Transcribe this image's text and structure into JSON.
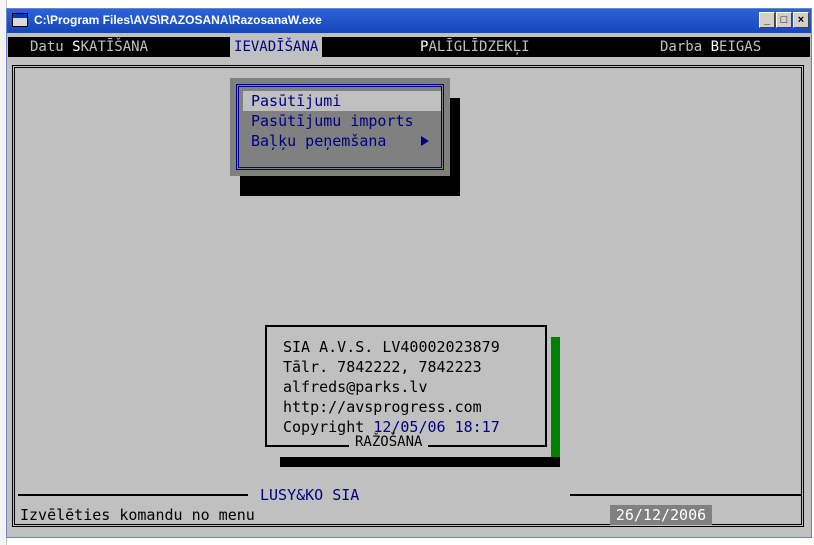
{
  "window": {
    "title": "C:\\Program Files\\AVS\\RAZOSANA\\RazosanaW.exe",
    "controls": {
      "minimize": "_",
      "maximize": "□",
      "close": "×"
    }
  },
  "menubar": {
    "items": [
      {
        "pre": "Datu ",
        "hot": "S",
        "post": "KATĪŠANA",
        "selected": false
      },
      {
        "pre": "",
        "hot": "I",
        "post": "EVADĪŠANA",
        "selected": true
      },
      {
        "pre": "",
        "hot": "P",
        "post": "ALĪGLĪDZEKĻI",
        "selected": false
      },
      {
        "pre": "Darba ",
        "hot": "B",
        "post": "EIGAS",
        "selected": false
      }
    ]
  },
  "dropdown": {
    "items": [
      {
        "label": "Pasūtījumi",
        "active": true
      },
      {
        "label": "Pasūtījumu imports",
        "active": false
      },
      {
        "label": "Baļķu peņemšana",
        "active": false
      }
    ]
  },
  "info": {
    "line1": "SIA A.V.S. LV40002023879",
    "line2": "Tālr. 7842222, 7842223",
    "line3": "alfreds@parks.lv",
    "line4": "http://avsprogress.com",
    "copyright_label": "Copyright",
    "copyright_date": "12/05/06 18:17",
    "app_name": "RAŽOŠANA"
  },
  "status": {
    "company": "LUSY&KO SIA",
    "prompt": "Izvēlēties komandu no menu",
    "date": "26/12/2006"
  },
  "colors": {
    "titlebar": "#1747b8",
    "console_bg": "#c0c0c0",
    "menu_text_blue": "#000080",
    "shadow_green": "#008000"
  }
}
